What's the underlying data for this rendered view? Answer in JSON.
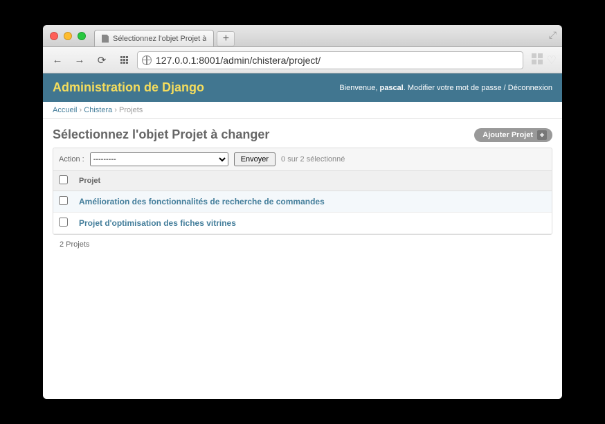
{
  "browser": {
    "tab_title": "Sélectionnez l'objet Projet à",
    "url": "127.0.0.1:8001/admin/chistera/project/",
    "newtab": "+"
  },
  "header": {
    "site_title": "Administration de Django",
    "welcome": "Bienvenue,",
    "username": "pascal",
    "dot": ".",
    "change_password": "Modifier votre mot de passe",
    "sep": "/",
    "logout": "Déconnexion"
  },
  "breadcrumbs": {
    "home": "Accueil",
    "app": "Chistera",
    "model": "Projets",
    "sep": "›"
  },
  "page": {
    "title": "Sélectionnez l'objet Projet à changer",
    "add_label": "Ajouter Projet",
    "plus": "+"
  },
  "actions": {
    "label": "Action :",
    "placeholder": "---------",
    "submit": "Envoyer",
    "selection_count": "0 sur 2 sélectionné"
  },
  "table": {
    "header": "Projet",
    "rows": [
      {
        "name": "Amélioration des fonctionnalités de recherche de commandes"
      },
      {
        "name": "Projet d'optimisation des fiches vitrines"
      }
    ]
  },
  "paginator": "2 Projets"
}
